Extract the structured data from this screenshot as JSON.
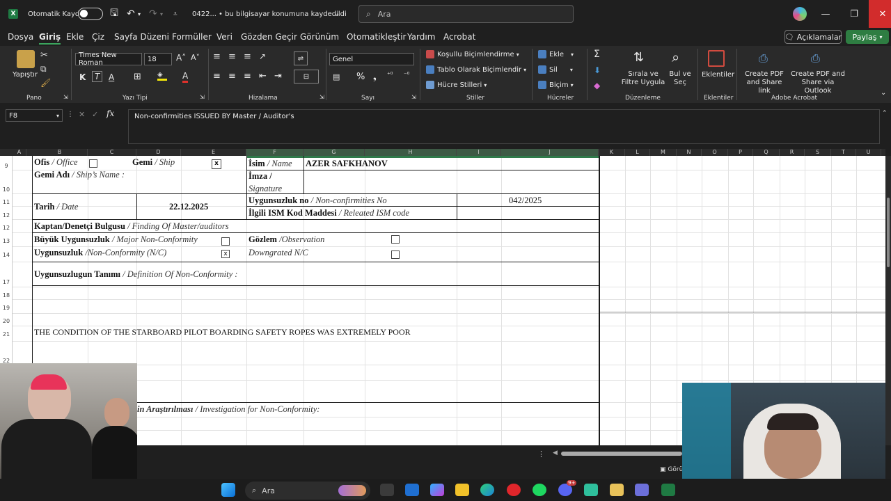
{
  "titlebar": {
    "autosave_label": "Otomatik Kaydet",
    "file_name": "0422...",
    "save_status": "• bu bilgisayar konumuna kaydedildi",
    "search_placeholder": "Ara"
  },
  "ribbon_tabs": [
    "Dosya",
    "Giriş",
    "Ekle",
    "Çiz",
    "Sayfa Düzeni",
    "Formüller",
    "Veri",
    "Gözden Geçir",
    "Görünüm",
    "Otomatikleştir",
    "Yardım",
    "Acrobat"
  ],
  "ribbon_actions": {
    "comments": "Açıklamalar",
    "share": "Paylaş"
  },
  "ribbon": {
    "paste": "Yapıştır",
    "font_name": "Times New Roman",
    "font_size": "18",
    "number_format": "Genel",
    "conditional_formatting": "Koşullu Biçimlendirme",
    "format_as_table": "Tablo Olarak Biçimlendir",
    "cell_styles": "Hücre Stilleri",
    "insert": "Ekle",
    "delete": "Sil",
    "format": "Biçim",
    "sort_filter": "Sırala ve Filtre Uygula",
    "find_select": "Bul ve Seç",
    "addins": "Eklentiler",
    "create_pdf_link": "Create PDF and Share link",
    "create_pdf_outlook": "Create PDF and Share via Outlook",
    "groups": {
      "clipboard": "Pano",
      "font": "Yazı Tipi",
      "alignment": "Hizalama",
      "number": "Sayı",
      "styles": "Stiller",
      "cells": "Hücreler",
      "editing": "Düzenleme",
      "addins": "Eklentiler",
      "acrobat": "Adobe Acrobat"
    },
    "bold": "K",
    "italic": "T",
    "underline": "A"
  },
  "formula_bar": {
    "name_box": "F8",
    "fx": "fx",
    "content": "Non-confirmities ISSUED BY Master / Auditor's"
  },
  "columns": [
    "A",
    "B",
    "C",
    "D",
    "E",
    "F",
    "G",
    "H",
    "I",
    "J",
    "K",
    "L",
    "M",
    "N",
    "O",
    "P",
    "Q",
    "R",
    "S",
    "T",
    "U"
  ],
  "rows": [
    "9",
    "10",
    "11",
    "12",
    "13",
    "14",
    "15",
    "17",
    "18",
    "19",
    "20",
    "21",
    "22"
  ],
  "form": {
    "office_tr": "Ofis",
    "office_en": "/ Office",
    "ship_tr": "Gemi",
    "ship_en": " / Ship",
    "ship_checked": "x",
    "ship_name_tr": "Gemi Adı",
    "ship_name_en": "/ Ship’s Name :",
    "name_tr": "İsim",
    "name_en": "/ Name",
    "name_value": "AZER SAFKHANOV",
    "signature_tr": "İmza /",
    "signature_en": "Signature",
    "date_tr": "Tarih",
    "date_en": "/ Date",
    "date_value": "22.12.2025",
    "nc_no_tr": "Uygunsuzluk no",
    "nc_no_en": "/ Non-confirmities No",
    "nc_no_value": "042/2025",
    "ism_tr": "İlgili ISM Kod Maddesi",
    "ism_en": "/ Releated ISM code",
    "finding_tr": "Kaptan/Denetçi Bulgusu",
    "finding_en": "/ Finding Of Master/auditors",
    "major_tr": "Büyük Uygunsuzluk",
    "major_en": "/ Major Non-Conformity",
    "nc_tr": "Uygunsuzluk",
    "nc_en": "/Non-Conformity (N/C)",
    "nc_checked": "x",
    "observation_tr": "Gözlem",
    "observation_en": "/Observation",
    "downgraded": "Downgrated N/C",
    "definition_tr": "Uygunsuzlugun Tanımı",
    "definition_en": "/ Definition Of Non-Conformity :",
    "description": "THE CONDITION OF THE STARBOARD PILOT BOARDING SAFETY ROPES WAS EXTREMELY POOR",
    "investigation_tr": "in Araştırılması",
    "investigation_en": " / Investigation for Non-Conformity:"
  },
  "statusbar": {
    "view_label": "Görü"
  },
  "taskbar": {
    "search": "Ara",
    "badge": "9+"
  }
}
